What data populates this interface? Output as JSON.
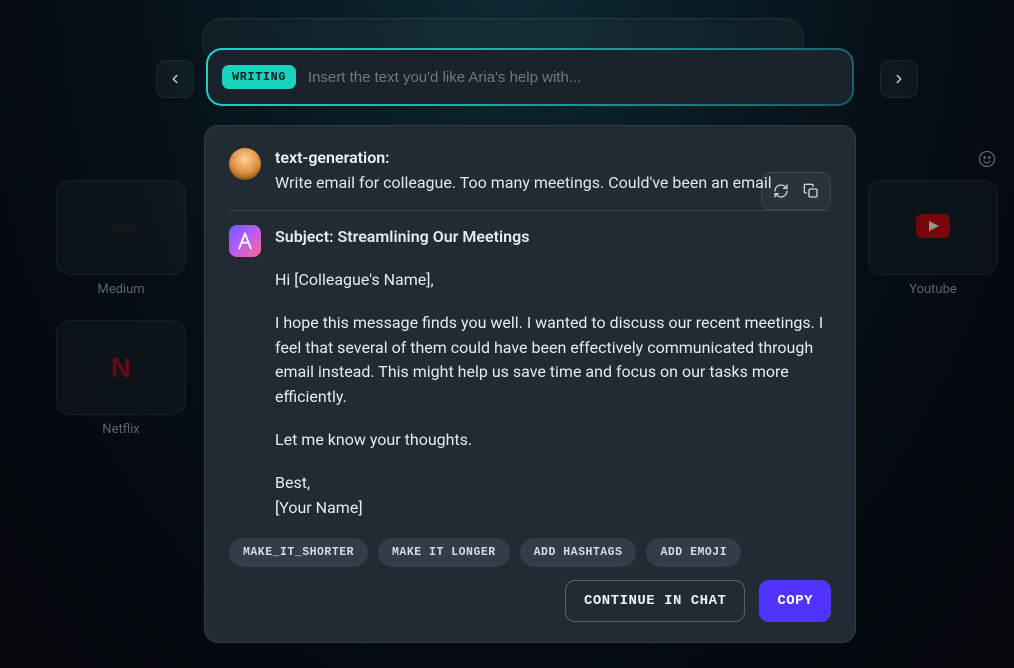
{
  "background_tiles": {
    "medium": {
      "label": "Medium"
    },
    "netflix": {
      "label": "Netflix"
    },
    "youtube": {
      "label": "Youtube"
    }
  },
  "input": {
    "mode_chip": "WRITING",
    "placeholder": "Insert the text you'd like Aria's help with..."
  },
  "conversation": {
    "user": {
      "title": "text-generation:",
      "prompt": "Write email for colleague. Too many meetings. Could've been an email"
    },
    "assistant": {
      "subject": "Subject: Streamlining Our Meetings",
      "greeting": "Hi [Colleague's Name],",
      "body": "I hope this message finds you well. I wanted to discuss our recent meetings. I feel that several of them could have been effectively communicated through email instead. This might help us save time and focus on our tasks more efficiently.",
      "closing": "Let me know your thoughts.",
      "signoff": "Best,",
      "signature": "[Your Name]"
    }
  },
  "suggestions": [
    "MAKE_IT_SHORTER",
    "MAKE IT LONGER",
    "ADD HASHTAGS",
    "ADD EMOJI"
  ],
  "footer": {
    "continue": "CONTINUE IN CHAT",
    "copy": "COPY"
  },
  "icons": {
    "regenerate": "regenerate-icon",
    "copy": "copy-icon",
    "emoji": "emoji-icon",
    "chevron_left": "chevron-left-icon",
    "chevron_right": "chevron-right-icon"
  }
}
